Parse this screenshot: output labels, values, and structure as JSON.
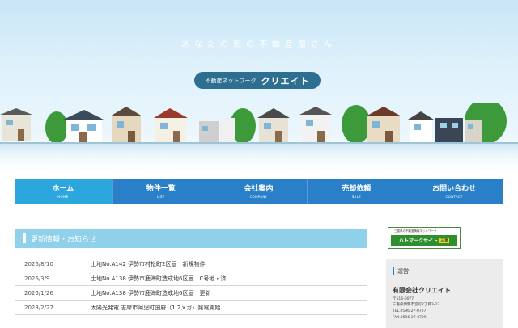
{
  "hero": {
    "tagline": "あなたの街の不動産屋さん",
    "logo_small": "不動産ネットワーク",
    "logo_big": "クリエイト"
  },
  "nav": {
    "items": [
      {
        "label": "ホーム",
        "sub": "HOME",
        "active": true
      },
      {
        "label": "物件一覧",
        "sub": "LIST",
        "active": false
      },
      {
        "label": "会社案内",
        "sub": "COMPANY",
        "active": false
      },
      {
        "label": "売却依頼",
        "sub": "SALE",
        "active": false
      },
      {
        "label": "お問い合わせ",
        "sub": "CONTACT",
        "active": false
      }
    ]
  },
  "news": {
    "title": "更新情報・お知らせ",
    "items": [
      {
        "date": "2026/8/10",
        "text": "土地No.A142 伊勢市村松町2区画　新規物件"
      },
      {
        "date": "2026/3/9",
        "text": "土地No.A138 伊勢市鹿海町造成地6区画　C号地・済"
      },
      {
        "date": "2026/1/26",
        "text": "土地No.A138 伊勢市鹿海町造成地6区画　更新"
      },
      {
        "date": "2023/2/27",
        "text": "太陽光発電 志摩市阿児町国府（1.2メガ）発電開始"
      }
    ]
  },
  "banner": {
    "top": "三重県の不動産情報ネットワーク",
    "main": "ハトマークサイト",
    "badge": "三重"
  },
  "sidebar": {
    "title": "運営",
    "company": "有限会社クリエイト",
    "postal": "〒516-0077",
    "address": "三重県伊勢市宮町2丁目3-23",
    "tel": "TEL.0596-27-0707",
    "fax": "FAX.0596-27-0709"
  },
  "colors": {
    "nav": "#2a80c8",
    "nav_active": "#2ba7dd",
    "news_header": "#8fd0eb",
    "logo_pill": "#2d6e91"
  }
}
